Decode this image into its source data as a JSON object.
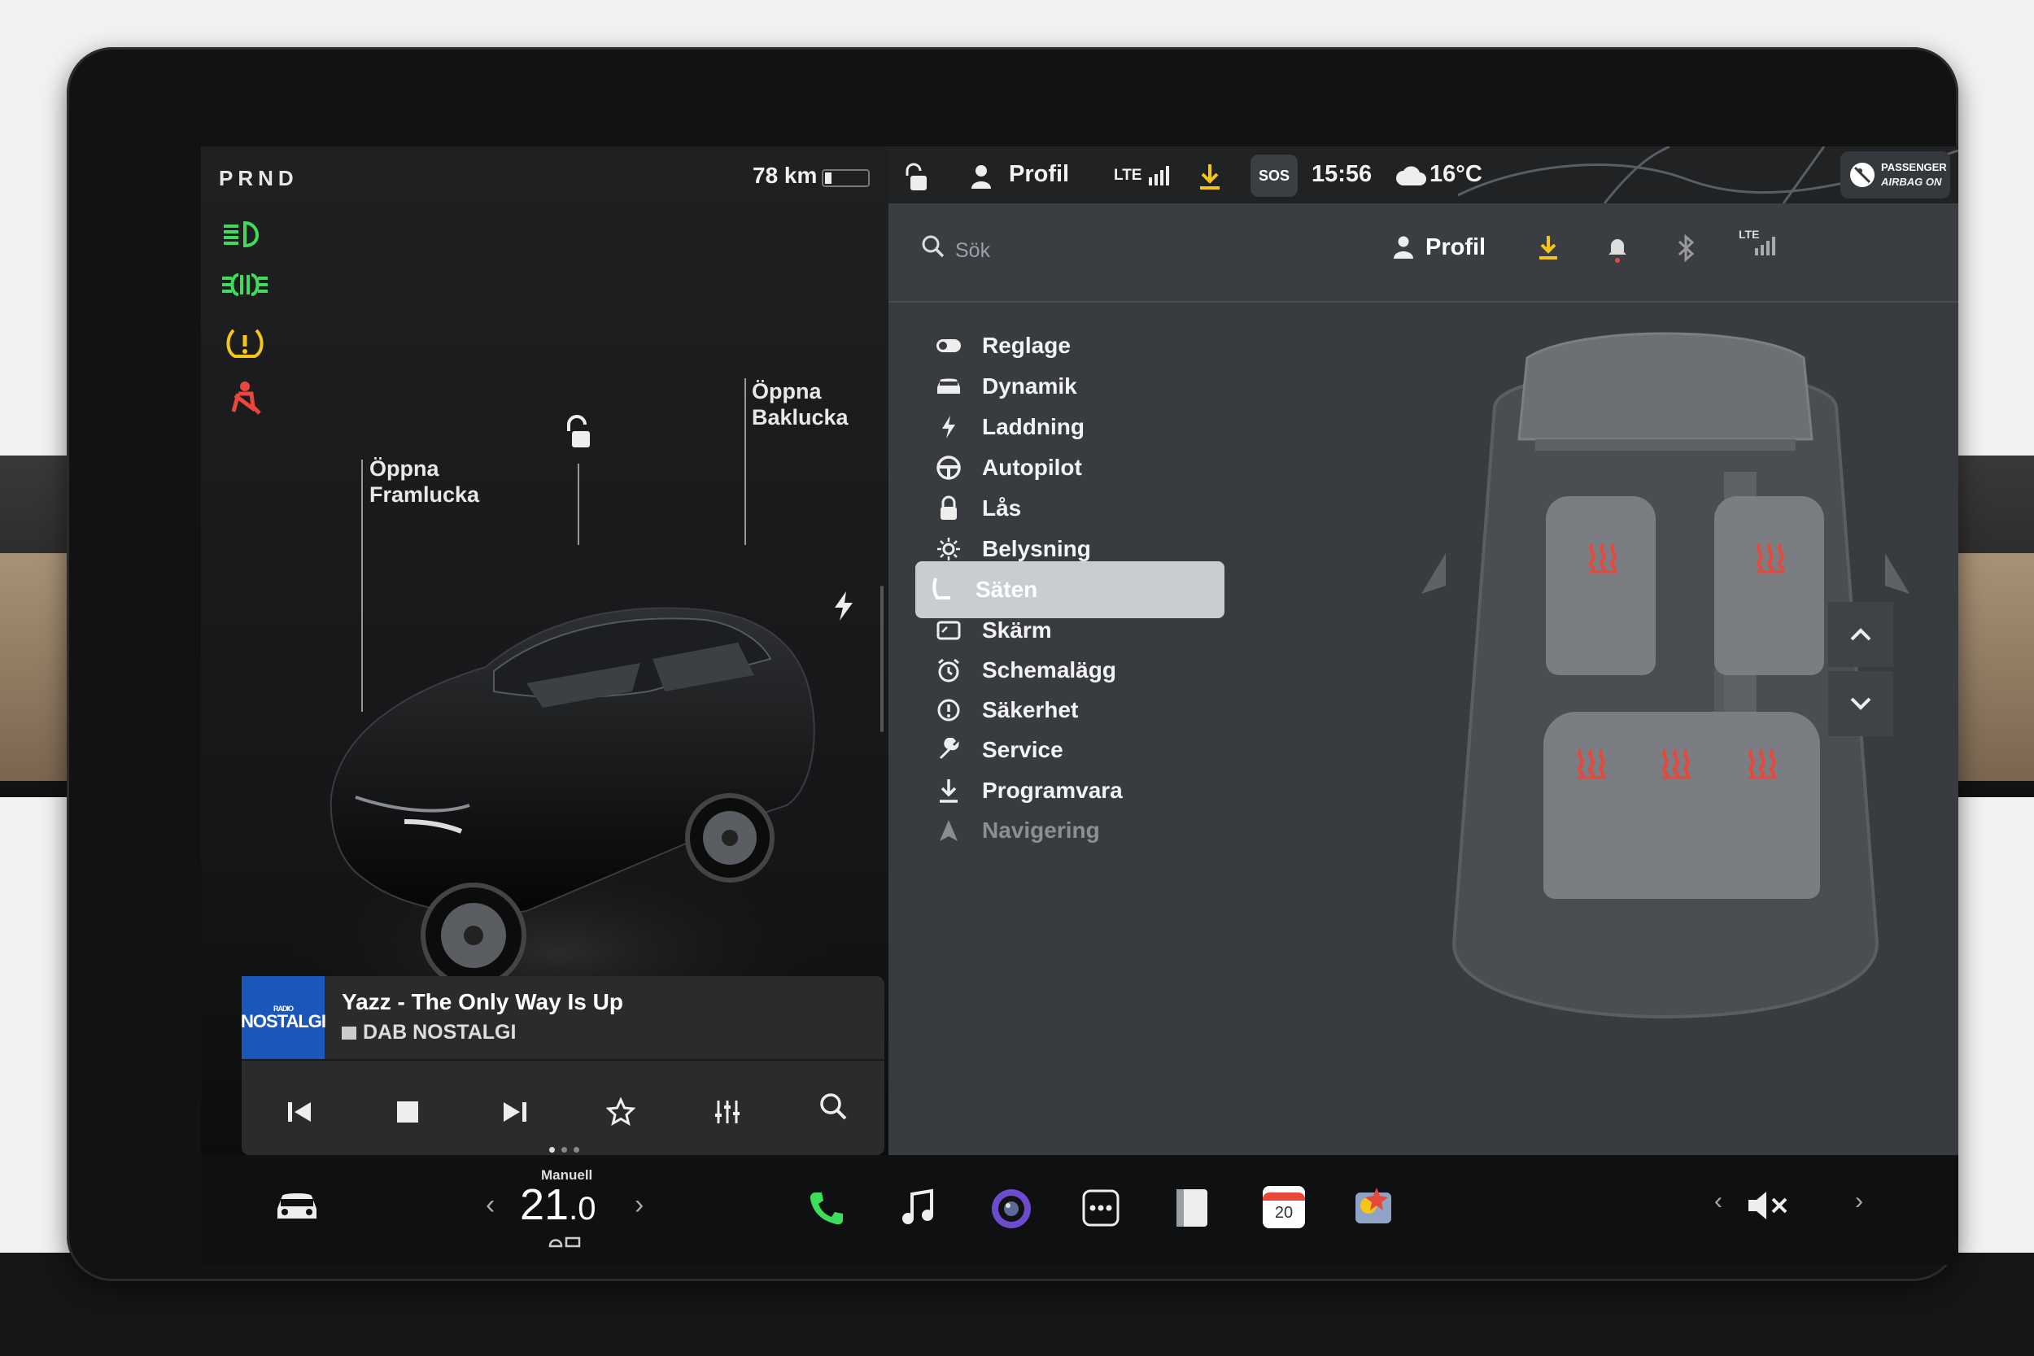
{
  "status_left": {
    "gear": "PRND",
    "range": "78 km"
  },
  "callouts": {
    "front": [
      "Öppna",
      "Framlucka"
    ],
    "rear": [
      "Öppna",
      "Baklucka"
    ]
  },
  "media": {
    "logo_top": "RADIO",
    "logo_main": "NOSTALGI",
    "song": "Yazz - The Only Way Is Up",
    "station": "DAB NOSTALGI",
    "controls": [
      "previous-icon",
      "stop-icon",
      "next-icon",
      "favorite-icon",
      "equalizer-icon",
      "search-icon"
    ]
  },
  "top_status": {
    "profile": "Profil",
    "network": "LTE",
    "sos": "SOS",
    "time": "15:56",
    "temperature": "16°C",
    "airbag_line1": "PASSENGER",
    "airbag_line2": "AIRBAG ON"
  },
  "search_bar": {
    "placeholder": "Sök",
    "profile": "Profil",
    "network": "LTE"
  },
  "menu": [
    {
      "label": "Reglage",
      "icon": "toggle-icon"
    },
    {
      "label": "Dynamik",
      "icon": "car-icon"
    },
    {
      "label": "Laddning",
      "icon": "lightning-icon"
    },
    {
      "label": "Autopilot",
      "icon": "steering-wheel-icon"
    },
    {
      "label": "Lås",
      "icon": "lock-icon"
    },
    {
      "label": "Belysning",
      "icon": "sun-icon"
    },
    {
      "label": "Säten",
      "icon": "seat-icon",
      "active": true
    },
    {
      "label": "Skärm",
      "icon": "display-icon"
    },
    {
      "label": "Schemalägg",
      "icon": "alarm-clock-icon"
    },
    {
      "label": "Säkerhet",
      "icon": "info-circle-icon"
    },
    {
      "label": "Service",
      "icon": "wrench-icon"
    },
    {
      "label": "Programvara",
      "icon": "download-icon"
    },
    {
      "label": "Navigering",
      "icon": "navigation-icon"
    }
  ],
  "taskbar": {
    "climate_mode": "Manuell",
    "temperature_whole": "21",
    "temperature_decimal": ".0",
    "calendar_day": "20"
  },
  "colors": {
    "accent_green": "#3ddc5a",
    "heat_red": "#e8473a",
    "download_yellow": "#f5c518",
    "active_menu_bg": "#c8cdd2"
  }
}
